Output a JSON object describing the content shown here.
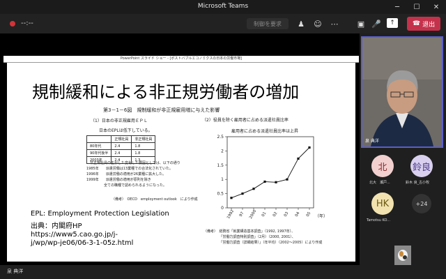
{
  "window": {
    "title": "Microsoft Teams"
  },
  "toolbar": {
    "timer": "--:--",
    "control_request": "制御を要求",
    "leave_label": "退出"
  },
  "presenter": {
    "name": "泉 典洋"
  },
  "slide": {
    "window_header": "PowerPoint スライド ショー - [ポストバブルエコノミクスの日本の労働市場]",
    "title": "規制緩和による非正規労働者の増加",
    "figure_title": "第3－1－6図　規制緩和が非正規雇用増に与えた影響",
    "left_subtitle": "（1）日本の非正規雇用ＥＰＬ",
    "left_caption": "日本のEPLは低下している。",
    "table": {
      "headers": [
        "",
        "正規社員",
        "非正規社員"
      ],
      "rows": [
        [
          "80年代",
          "2.4",
          "1.8"
        ],
        [
          "90年代後半",
          "2.4",
          "1.8"
        ],
        [
          "2003年",
          "2.4",
          "1.3"
        ]
      ]
    },
    "notes": "　非正規社員の主がした変化した要因としては、以下の通り\n1985年　　派遣労働は13業種での合法化されていた。\n1996年　　派遣労働の適用が26業種に拡大した。\n1999年　　派遣労働の適用が原則を除き\n　　　　　全ての職種で認められるようになった。",
    "left_source": "（備考）　OECD　employment outlook　により作成",
    "epl_label": "EPL: Employment Protection Legislation",
    "source_lines": [
      "出典：内閣府HP",
      "https://www5.cao.go.jp/j-",
      "j/wp/wp-je06/06-3-1-05z.html"
    ],
    "chart_title": "（2）役員を除く雇用者に占める派遣社員比率",
    "chart_caption": "雇用者に占める派遣社員比率は上昇",
    "chart_footer": "（備考）　総務省「就業構造基本調査」（1992, 1997年）、\n　　　　　「労働力調査特別調査」（2月）（2000, 2001）、\n　　　　　「労働力調査（詳細結果）」（年平均）（2002～2005）により作成"
  },
  "participants": [
    {
      "initials": "北",
      "name": "北大　瀬戸...",
      "bg": "#f2d0d0",
      "fg": "#8a2b2b"
    },
    {
      "initials": "鈴良",
      "name": "鈴木 良_古小牧",
      "bg": "#d8d0ee",
      "fg": "#4b3a8a"
    },
    {
      "initials": "HK",
      "name": "Tamotsu KO...",
      "bg": "#f1e2b0",
      "fg": "#6b5a10"
    }
  ],
  "more_participants": "+24",
  "chart_data": {
    "type": "line",
    "title": "雇用者に占める派遣社員比率は上昇",
    "xlabel": "（年）",
    "ylabel": "",
    "x": [
      "1992",
      "97",
      "2000",
      "01",
      "02",
      "03",
      "04",
      "05"
    ],
    "x_ticks": [
      "1992",
      "97",
      "2000",
      "01",
      "02",
      "03",
      "04",
      "05"
    ],
    "y_ticks": [
      "0",
      "0.5",
      "1",
      "1.5",
      "2",
      "2.5"
    ],
    "series": [
      {
        "name": "",
        "values": [
          0.35,
          0.5,
          0.67,
          0.92,
          0.9,
          1.0,
          1.73,
          2.12
        ]
      }
    ],
    "ylim": [
      0,
      2.5
    ],
    "grid": false
  }
}
